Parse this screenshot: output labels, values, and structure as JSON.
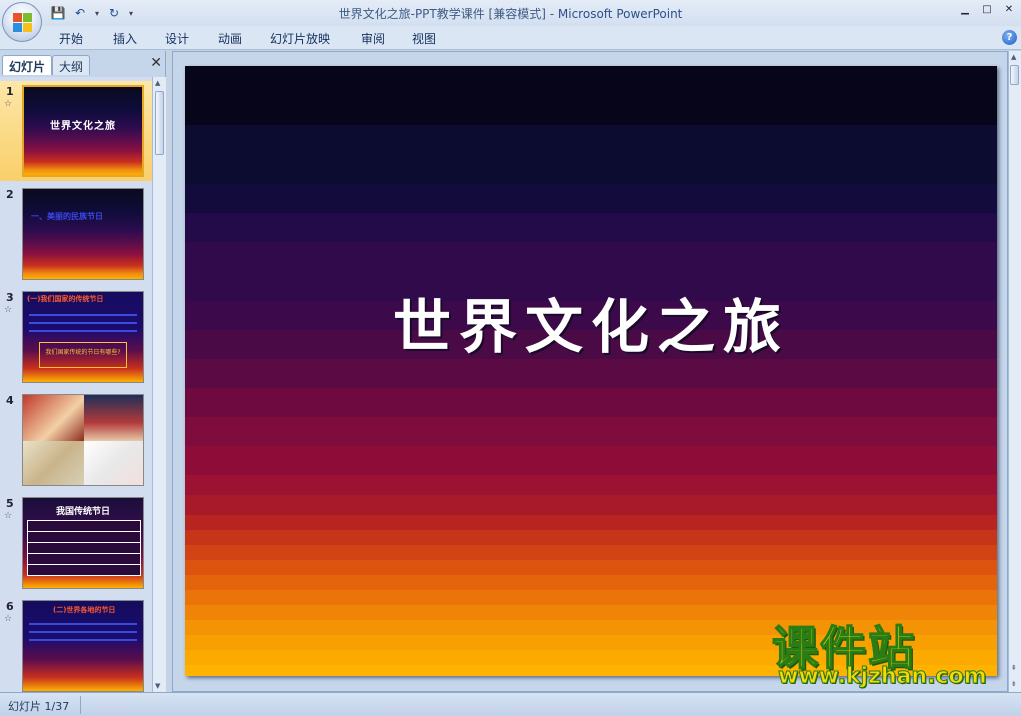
{
  "window": {
    "title": "世界文化之旅-PPT教学课件 [兼容模式] - ",
    "app_name": "Microsoft PowerPoint",
    "minimize": "▁",
    "maximize": "□",
    "close": "✕"
  },
  "qat": {
    "save": "💾",
    "undo": "↶",
    "redo": "↻",
    "dropdown": "▾",
    "customize": "▾"
  },
  "ribbon_tabs": [
    "开始",
    "插入",
    "设计",
    "动画",
    "幻灯片放映",
    "审阅",
    "视图"
  ],
  "help": "?",
  "left_pane": {
    "tab_slides": "幻灯片",
    "tab_outline": "大纲",
    "close": "✕",
    "slides": [
      {
        "num": "1",
        "star": "☆",
        "caption": "世界文化之旅"
      },
      {
        "num": "2",
        "star": "",
        "caption": "一、美丽的民族节日"
      },
      {
        "num": "3",
        "star": "☆",
        "caption": "(一)我们国家的传统节日",
        "box": "我们国家传统的节日有哪些?"
      },
      {
        "num": "4",
        "star": "",
        "caption": ""
      },
      {
        "num": "5",
        "star": "☆",
        "caption": "我国传统节日"
      },
      {
        "num": "6",
        "star": "☆",
        "caption": "(二)世界各地的节日"
      }
    ]
  },
  "slide": {
    "title": "世界文化之旅"
  },
  "watermark": {
    "cn": "课件站",
    "url": "www.kjzhan.com"
  },
  "status": {
    "slide_counter": "幻灯片 1/37"
  },
  "colors": {
    "slide_top": "#06051a",
    "slide_bottom": "#ffad00",
    "watermark": "#f5d90a",
    "watermark_outline": "#2a7d14"
  }
}
